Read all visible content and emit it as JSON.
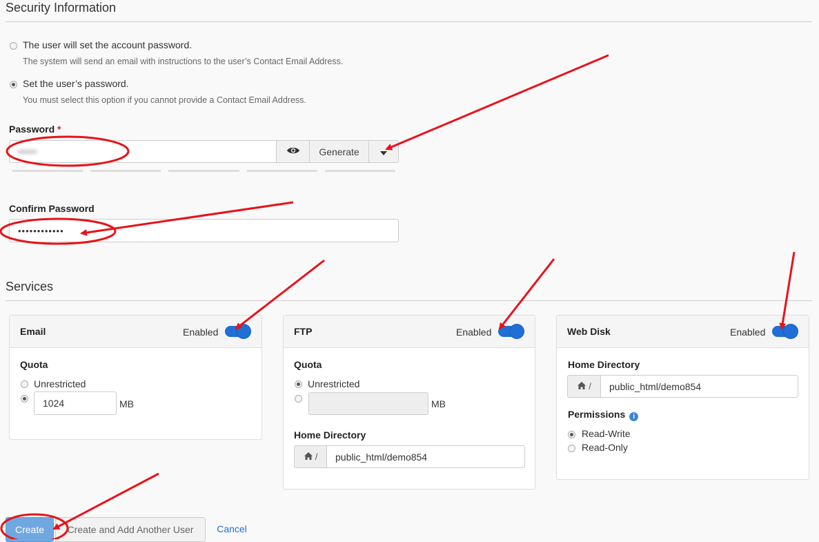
{
  "security": {
    "heading": "Security Information",
    "option_user": {
      "label": "The user will set the account password.",
      "help": "The system will send an email with instructions to the user’s Contact Email Address.",
      "checked": false
    },
    "option_set": {
      "label": "Set the user’s password.",
      "help": "You must select this option if you cannot provide a Contact Email Address.",
      "checked": true
    },
    "password": {
      "label": "Password",
      "required_mark": "*",
      "generate_label": "Generate",
      "show_icon": "eye-icon",
      "dropdown_icon": "caret-down-icon"
    },
    "confirm_password": {
      "label": "Confirm Password",
      "value": "••••••••••••"
    }
  },
  "services": {
    "heading": "Services",
    "email": {
      "title": "Email",
      "enabled_label": "Enabled",
      "enabled": true,
      "quota_label": "Quota",
      "unrestricted_label": "Unrestricted",
      "unrestricted_checked": false,
      "quota_value": "1024",
      "quota_unit": "MB"
    },
    "ftp": {
      "title": "FTP",
      "enabled_label": "Enabled",
      "enabled": true,
      "quota_label": "Quota",
      "unrestricted_label": "Unrestricted",
      "unrestricted_checked": true,
      "quota_value": "",
      "quota_unit": "MB",
      "home_label": "Home Directory",
      "home_prefix": "/",
      "home_value": "public_html/demo854"
    },
    "webdisk": {
      "title": "Web Disk",
      "enabled_label": "Enabled",
      "enabled": true,
      "home_label": "Home Directory",
      "home_prefix": "/",
      "home_value": "public_html/demo854",
      "permissions_label": "Permissions",
      "info_icon": "info-icon",
      "perm_rw": "Read-Write",
      "perm_ro": "Read-Only",
      "perm_selected": "Read-Write"
    }
  },
  "actions": {
    "create": "Create",
    "create_another": "Create and Add Another User",
    "cancel": "Cancel"
  },
  "annotation_color": "#e8121a"
}
